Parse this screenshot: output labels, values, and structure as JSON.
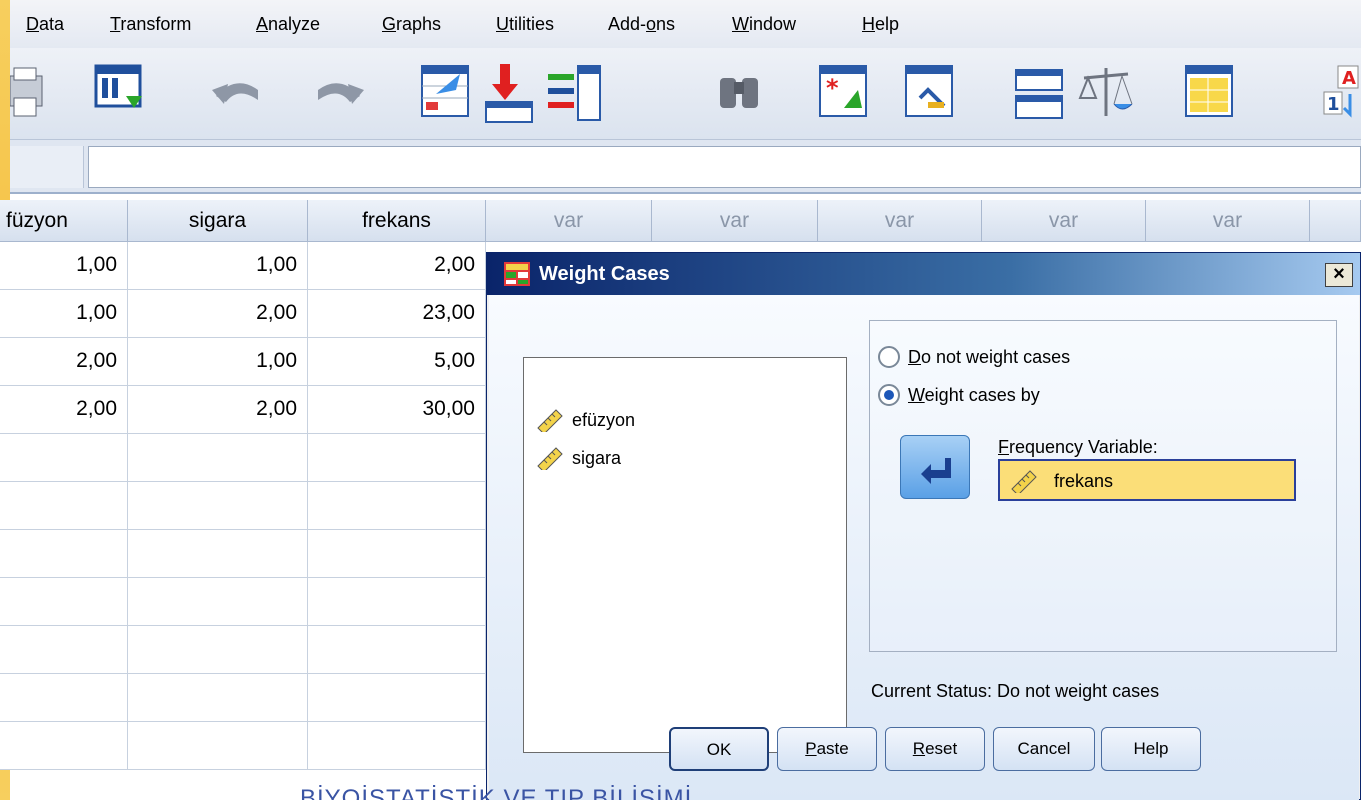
{
  "menu": {
    "items": [
      {
        "label": "Data",
        "underline": "D",
        "rest": "ata"
      },
      {
        "label": "Transform",
        "underline": "T",
        "rest": "ransform"
      },
      {
        "label": "Analyze",
        "underline": "A",
        "rest": "nalyze"
      },
      {
        "label": "Graphs",
        "underline": "G",
        "rest": "raphs"
      },
      {
        "label": "Utilities",
        "underline": "U",
        "rest": "tilities"
      },
      {
        "label": "Add-ons",
        "pre": "Add-",
        "underline": "o",
        "rest": "ns"
      },
      {
        "label": "Window",
        "underline": "W",
        "rest": "indow"
      },
      {
        "label": "Help",
        "underline": "H",
        "rest": "elp"
      }
    ]
  },
  "grid": {
    "headers": [
      "füzyon",
      "sigara",
      "frekans",
      "var",
      "var",
      "var",
      "var",
      "var"
    ],
    "rows": [
      [
        "1,00",
        "1,00",
        "2,00"
      ],
      [
        "1,00",
        "2,00",
        "23,00"
      ],
      [
        "2,00",
        "1,00",
        "5,00"
      ],
      [
        "2,00",
        "2,00",
        "30,00"
      ]
    ]
  },
  "dialog": {
    "title": "Weight Cases",
    "close": "×",
    "variables": [
      "efüzyon",
      "sigara"
    ],
    "radio_not_weight": {
      "underline": "D",
      "rest": "o not weight cases"
    },
    "radio_weight_by": {
      "underline": "W",
      "rest": "eight cases by"
    },
    "freq_label": {
      "underline": "F",
      "rest": "requency Variable:"
    },
    "freq_value": "frekans",
    "current_status": "Current Status: Do not weight cases",
    "buttons": {
      "ok": "OK",
      "paste": {
        "underline": "P",
        "rest": "aste"
      },
      "reset": {
        "underline": "R",
        "rest": "eset"
      },
      "cancel": "Cancel",
      "help": "Help"
    }
  },
  "footer": "BİYOİSTATİSTİK VE TIP BİLİŞİMİ",
  "colors": {
    "accent": "#0a246a",
    "frequency_field": "#fbde78",
    "footer_text": "#3a54a4"
  }
}
